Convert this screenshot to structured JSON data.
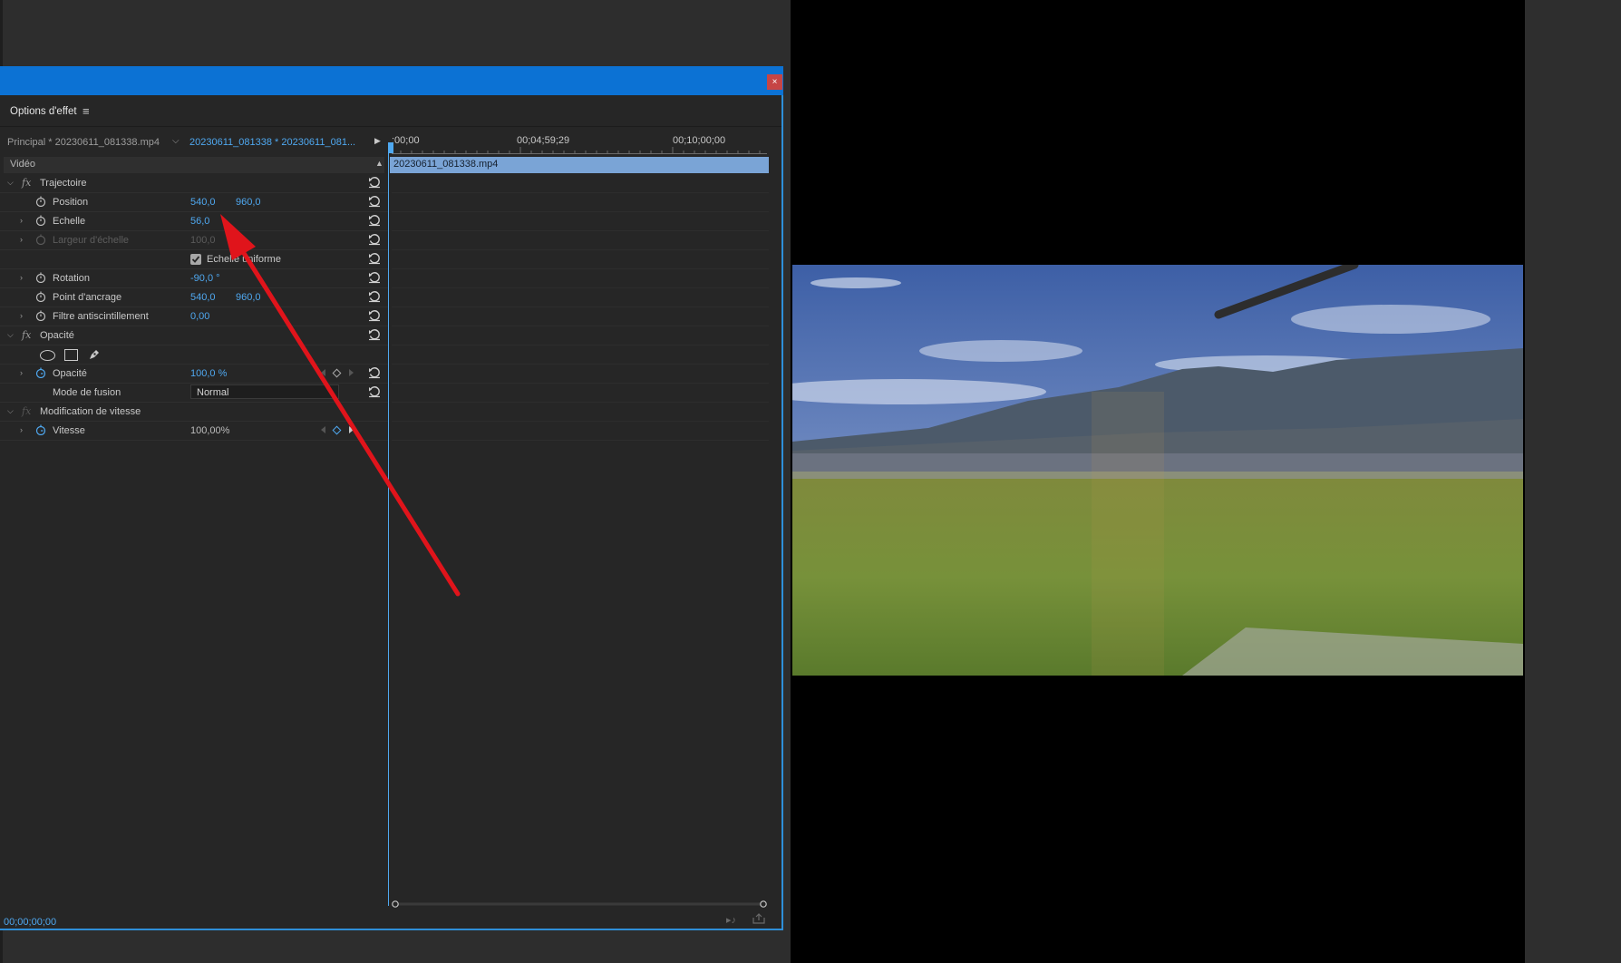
{
  "panel": {
    "tab_title": "Options d'effet",
    "menu_glyph": "≡",
    "close_glyph": "×",
    "source_label": "Principal * 20230611_081338.mp4",
    "clip_label": "20230611_081338 * 20230611_081...",
    "section_video": "Vidéo"
  },
  "timeline": {
    "tc_start": ":00;00",
    "tc_mid": "00;04;59;29",
    "tc_end": "00;10;00;00",
    "clip_name": "20230611_081338.mp4",
    "current_time": "00;00;00;00"
  },
  "effects": {
    "trajectoire": {
      "label": "Trajectoire",
      "position": {
        "label": "Position",
        "x": "540,0",
        "y": "960,0"
      },
      "echelle": {
        "label": "Echelle",
        "value": "56,0"
      },
      "largeur": {
        "label": "Largeur d'échelle",
        "value": "100,0"
      },
      "uniform": {
        "label": "Echelle uniforme",
        "checked": true
      },
      "rotation": {
        "label": "Rotation",
        "value": "-90,0 °"
      },
      "ancrage": {
        "label": "Point d'ancrage",
        "x": "540,0",
        "y": "960,0"
      },
      "filtre": {
        "label": "Filtre antiscintillement",
        "value": "0,00"
      }
    },
    "opacite": {
      "label": "Opacité",
      "opacite": {
        "label": "Opacité",
        "value": "100,0 %"
      },
      "fusion": {
        "label": "Mode de fusion",
        "value": "Normal"
      }
    },
    "vitesse": {
      "label": "Modification de vitesse",
      "vitesse": {
        "label": "Vitesse",
        "value": "100,00%"
      }
    }
  },
  "icons": {
    "reset": "reset-icon",
    "stopwatch": "stopwatch-icon",
    "twirl": "chevron-right-icon"
  },
  "colors": {
    "titlebar": "#0c72d4",
    "accent_value": "#4fa8f0",
    "clip_bar": "#7aa4d6",
    "close": "#c64545",
    "annotation_arrow": "#e0141b"
  }
}
